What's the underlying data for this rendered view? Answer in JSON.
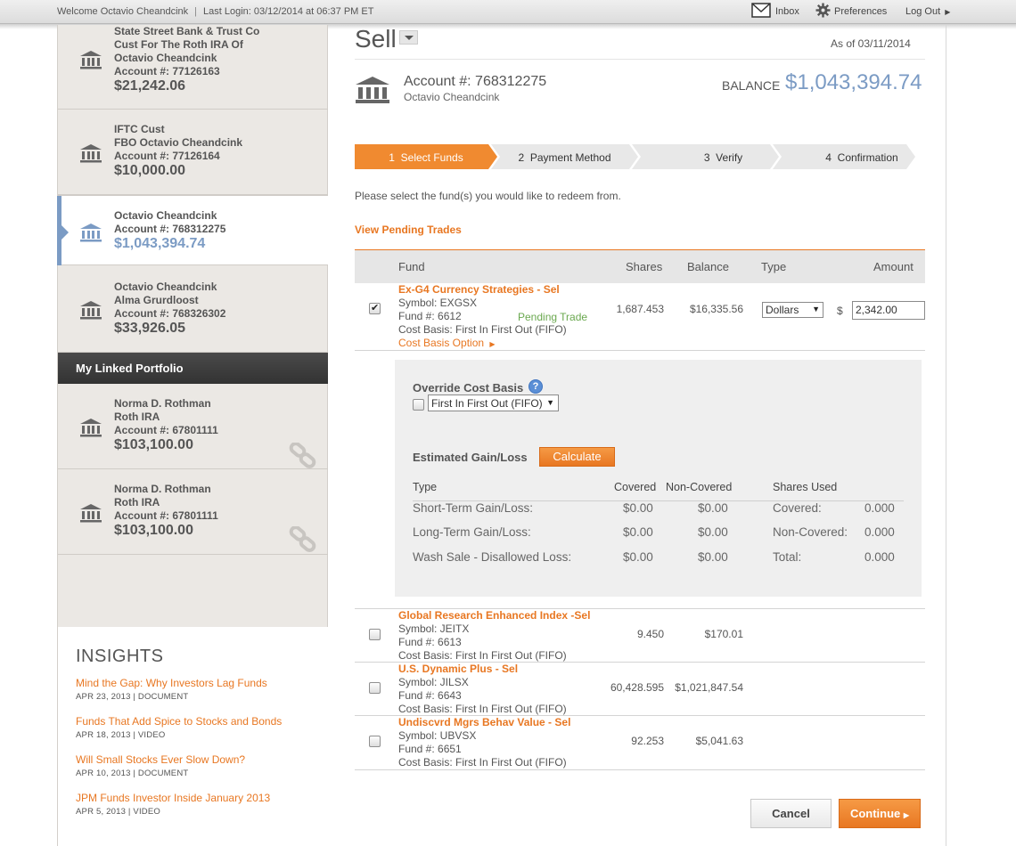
{
  "topbar": {
    "welcome": "Welcome Octavio Cheandcink",
    "separator": "|",
    "last_login": "Last Login: 03/12/2014 at 06:37 PM ET",
    "inbox": "Inbox",
    "preferences": "Preferences",
    "logout": "Log Out"
  },
  "sidebar": {
    "accounts": [
      {
        "line1": "State Street Bank & Trust Co",
        "line2": "Cust For The Roth IRA Of",
        "line3": "Octavio Cheandcink",
        "line4": "Account #: 77126163",
        "balance": "$21,242.06"
      },
      {
        "line1": "IFTC Cust",
        "line2": "FBO Octavio Cheandcink",
        "line3": "Account #: 77126164",
        "balance": "$10,000.00"
      },
      {
        "line1": "Octavio Cheandcink",
        "line2": "Account #: 768312275",
        "balance": "$1,043,394.74"
      },
      {
        "line1": "Octavio Cheandcink",
        "line2": "Alma Grurdloost",
        "line3": "Account #: 768326302",
        "balance": "$33,926.05"
      }
    ],
    "linked_header": "My Linked Portfolio",
    "linked": [
      {
        "line1": "Norma D. Rothman",
        "line2": "Roth IRA",
        "line3": "Account #: 67801111",
        "balance": "$103,100.00"
      },
      {
        "line1": "Norma D. Rothman",
        "line2": "Roth IRA",
        "line3": "Account #: 67801111",
        "balance": "$103,100.00"
      }
    ],
    "insights": {
      "title": "INSIGHTS",
      "items": [
        {
          "title": "Mind the Gap: Why Investors Lag Funds",
          "meta": "APR 23, 2013 | DOCUMENT"
        },
        {
          "title": "Funds That Add Spice to Stocks and Bonds",
          "meta": "APR 18, 2013 | VIDEO"
        },
        {
          "title": "Will Small Stocks Ever Slow Down?",
          "meta": "APR 10, 2013 | DOCUMENT"
        },
        {
          "title": "JPM Funds Investor Inside January 2013",
          "meta": "APR 5, 2013 | VIDEO"
        }
      ]
    }
  },
  "main": {
    "title": "Sell",
    "as_of": "As of 03/11/2014",
    "account_number": "Account #: 768312275",
    "account_name": "Octavio Cheandcink",
    "balance_label": "BALANCE",
    "balance_value": "$1,043,394.74",
    "steps": [
      {
        "num": "1",
        "label": "Select Funds"
      },
      {
        "num": "2",
        "label": "Payment Method"
      },
      {
        "num": "3",
        "label": "Verify"
      },
      {
        "num": "4",
        "label": "Confirmation"
      }
    ],
    "instruction": "Please select the fund(s) you would like to redeem from.",
    "pending_link": "View Pending Trades",
    "table": {
      "headers": {
        "fund": "Fund",
        "shares": "Shares",
        "balance": "Balance",
        "type": "Type",
        "amount": "Amount"
      },
      "rows": [
        {
          "name": "Ex-G4 Currency Strategies - Sel",
          "symbol": "Symbol: EXGSX",
          "fund_no": "Fund #: 6612",
          "cost_basis": "Cost Basis: First In First Out (FIFO)",
          "cost_basis_option": "Cost Basis Option",
          "pending": "Pending Trade",
          "shares": "1,687.453",
          "balance": "$16,335.56",
          "type": "Dollars",
          "currency": "$",
          "amount": "2,342.00",
          "checked": true
        },
        {
          "name": "Global Research Enhanced Index -Sel",
          "symbol": "Symbol: JEITX",
          "fund_no": "Fund #: 6613",
          "cost_basis": "Cost Basis: First In First Out (FIFO)",
          "shares": "9.450",
          "balance": "$170.01",
          "checked": false
        },
        {
          "name": "U.S. Dynamic Plus - Sel",
          "symbol": "Symbol: JILSX",
          "fund_no": "Fund #: 6643",
          "cost_basis": "Cost Basis: First In First Out (FIFO)",
          "shares": "60,428.595",
          "balance": "$1,021,847.54",
          "checked": false
        },
        {
          "name": "Undiscvrd Mgrs Behav Value - Sel",
          "symbol": "Symbol: UBVSX",
          "fund_no": "Fund #: 6651",
          "cost_basis": "Cost Basis: First In First Out (FIFO)",
          "shares": "92.253",
          "balance": "$5,041.63",
          "checked": false
        }
      ]
    },
    "override": {
      "title": "Override Cost Basis",
      "help": "?",
      "select_value": "First In First Out (FIFO)",
      "estimated_label": "Estimated Gain/Loss",
      "calculate": "Calculate",
      "headers": {
        "type": "Type",
        "covered": "Covered",
        "non_covered": "Non-Covered",
        "shares_used": "Shares Used"
      },
      "rows": [
        {
          "type": "Short-Term Gain/Loss:",
          "covered": "$0.00",
          "non_covered": "$0.00",
          "su_label": "Covered:",
          "su_value": "0.000"
        },
        {
          "type": "Long-Term Gain/Loss:",
          "covered": "$0.00",
          "non_covered": "$0.00",
          "su_label": "Non-Covered:",
          "su_value": "0.000"
        },
        {
          "type": "Wash Sale - Disallowed Loss:",
          "covered": "$0.00",
          "non_covered": "$0.00",
          "su_label": "Total:",
          "su_value": "0.000"
        }
      ]
    },
    "buttons": {
      "cancel": "Cancel",
      "continue": "Continue"
    },
    "colors": {
      "accent_orange": "#e87722",
      "balance_blue": "#7b9bc4",
      "pending_green": "#6aa84f"
    }
  }
}
